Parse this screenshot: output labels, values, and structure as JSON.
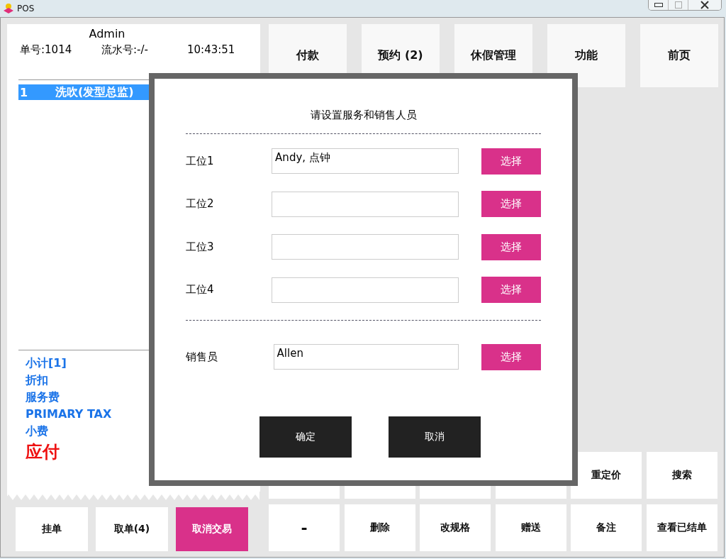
{
  "window": {
    "title": "POS"
  },
  "receipt": {
    "operator": "Admin",
    "order_no": "单号:1014",
    "serial_no": "流水号:-/-",
    "time": "10:43:51",
    "lines": [
      {
        "index": "1",
        "name": "洗吹(发型总监)",
        "selected": true
      }
    ],
    "summary": [
      {
        "label": "小计[1]",
        "kind": "normal"
      },
      {
        "label": "折扣",
        "kind": "normal"
      },
      {
        "label": "服务费",
        "kind": "normal"
      },
      {
        "label": "PRIMARY TAX",
        "kind": "normal"
      },
      {
        "label": "小费",
        "kind": "normal"
      },
      {
        "label": "应付",
        "kind": "due"
      }
    ]
  },
  "top_buttons": [
    "付款",
    "预约 (2)",
    "休假管理",
    "功能",
    "前页"
  ],
  "keypad": [
    {
      "label": "重定价"
    },
    {
      "label": "搜索"
    },
    {
      "label": "-"
    },
    {
      "label": "删除"
    },
    {
      "label": "改规格"
    },
    {
      "label": "赠送"
    },
    {
      "label": "备注"
    },
    {
      "label": "查看已结单"
    }
  ],
  "left_buttons": [
    {
      "label": "挂单",
      "kind": "normal"
    },
    {
      "label": "取单(4)",
      "kind": "normal"
    },
    {
      "label": "取消交易",
      "kind": "accent"
    }
  ],
  "dialog": {
    "title": "请设置服务和销售人员",
    "slots": [
      {
        "label": "工位1",
        "value": "Andy, 点钟",
        "button": "选择"
      },
      {
        "label": "工位2",
        "button": "选择"
      },
      {
        "label": "工位3",
        "button": "选择"
      },
      {
        "label": "工位4",
        "button": "选择"
      }
    ],
    "sales": {
      "label": "销售员",
      "value": "Allen",
      "button": "选择"
    },
    "buttons": [
      "确定",
      "取消"
    ]
  }
}
